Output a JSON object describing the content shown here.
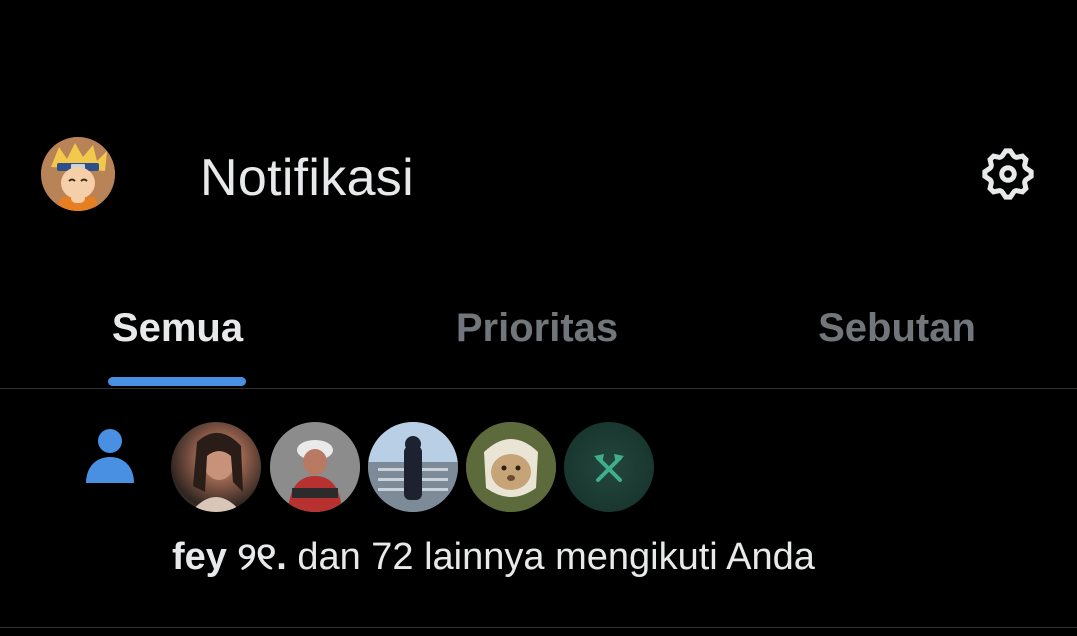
{
  "header": {
    "title": "Notifikasi",
    "avatar_icon": "user-avatar",
    "settings_icon": "gear-icon"
  },
  "tabs": [
    {
      "label": "Semua",
      "active": true
    },
    {
      "label": "Prioritas",
      "active": false
    },
    {
      "label": "Sebutan",
      "active": false
    }
  ],
  "colors": {
    "background": "#000000",
    "text": "#e7e9ea",
    "muted": "#71767b",
    "accent": "#4a90e2",
    "divider": "#2f3336"
  },
  "notifications": [
    {
      "type": "follow",
      "icon": "person-icon",
      "follower_count_shown": 5,
      "name": "fey ୨୧.",
      "message": " dan 72 lainnya mengikuti Anda"
    }
  ]
}
